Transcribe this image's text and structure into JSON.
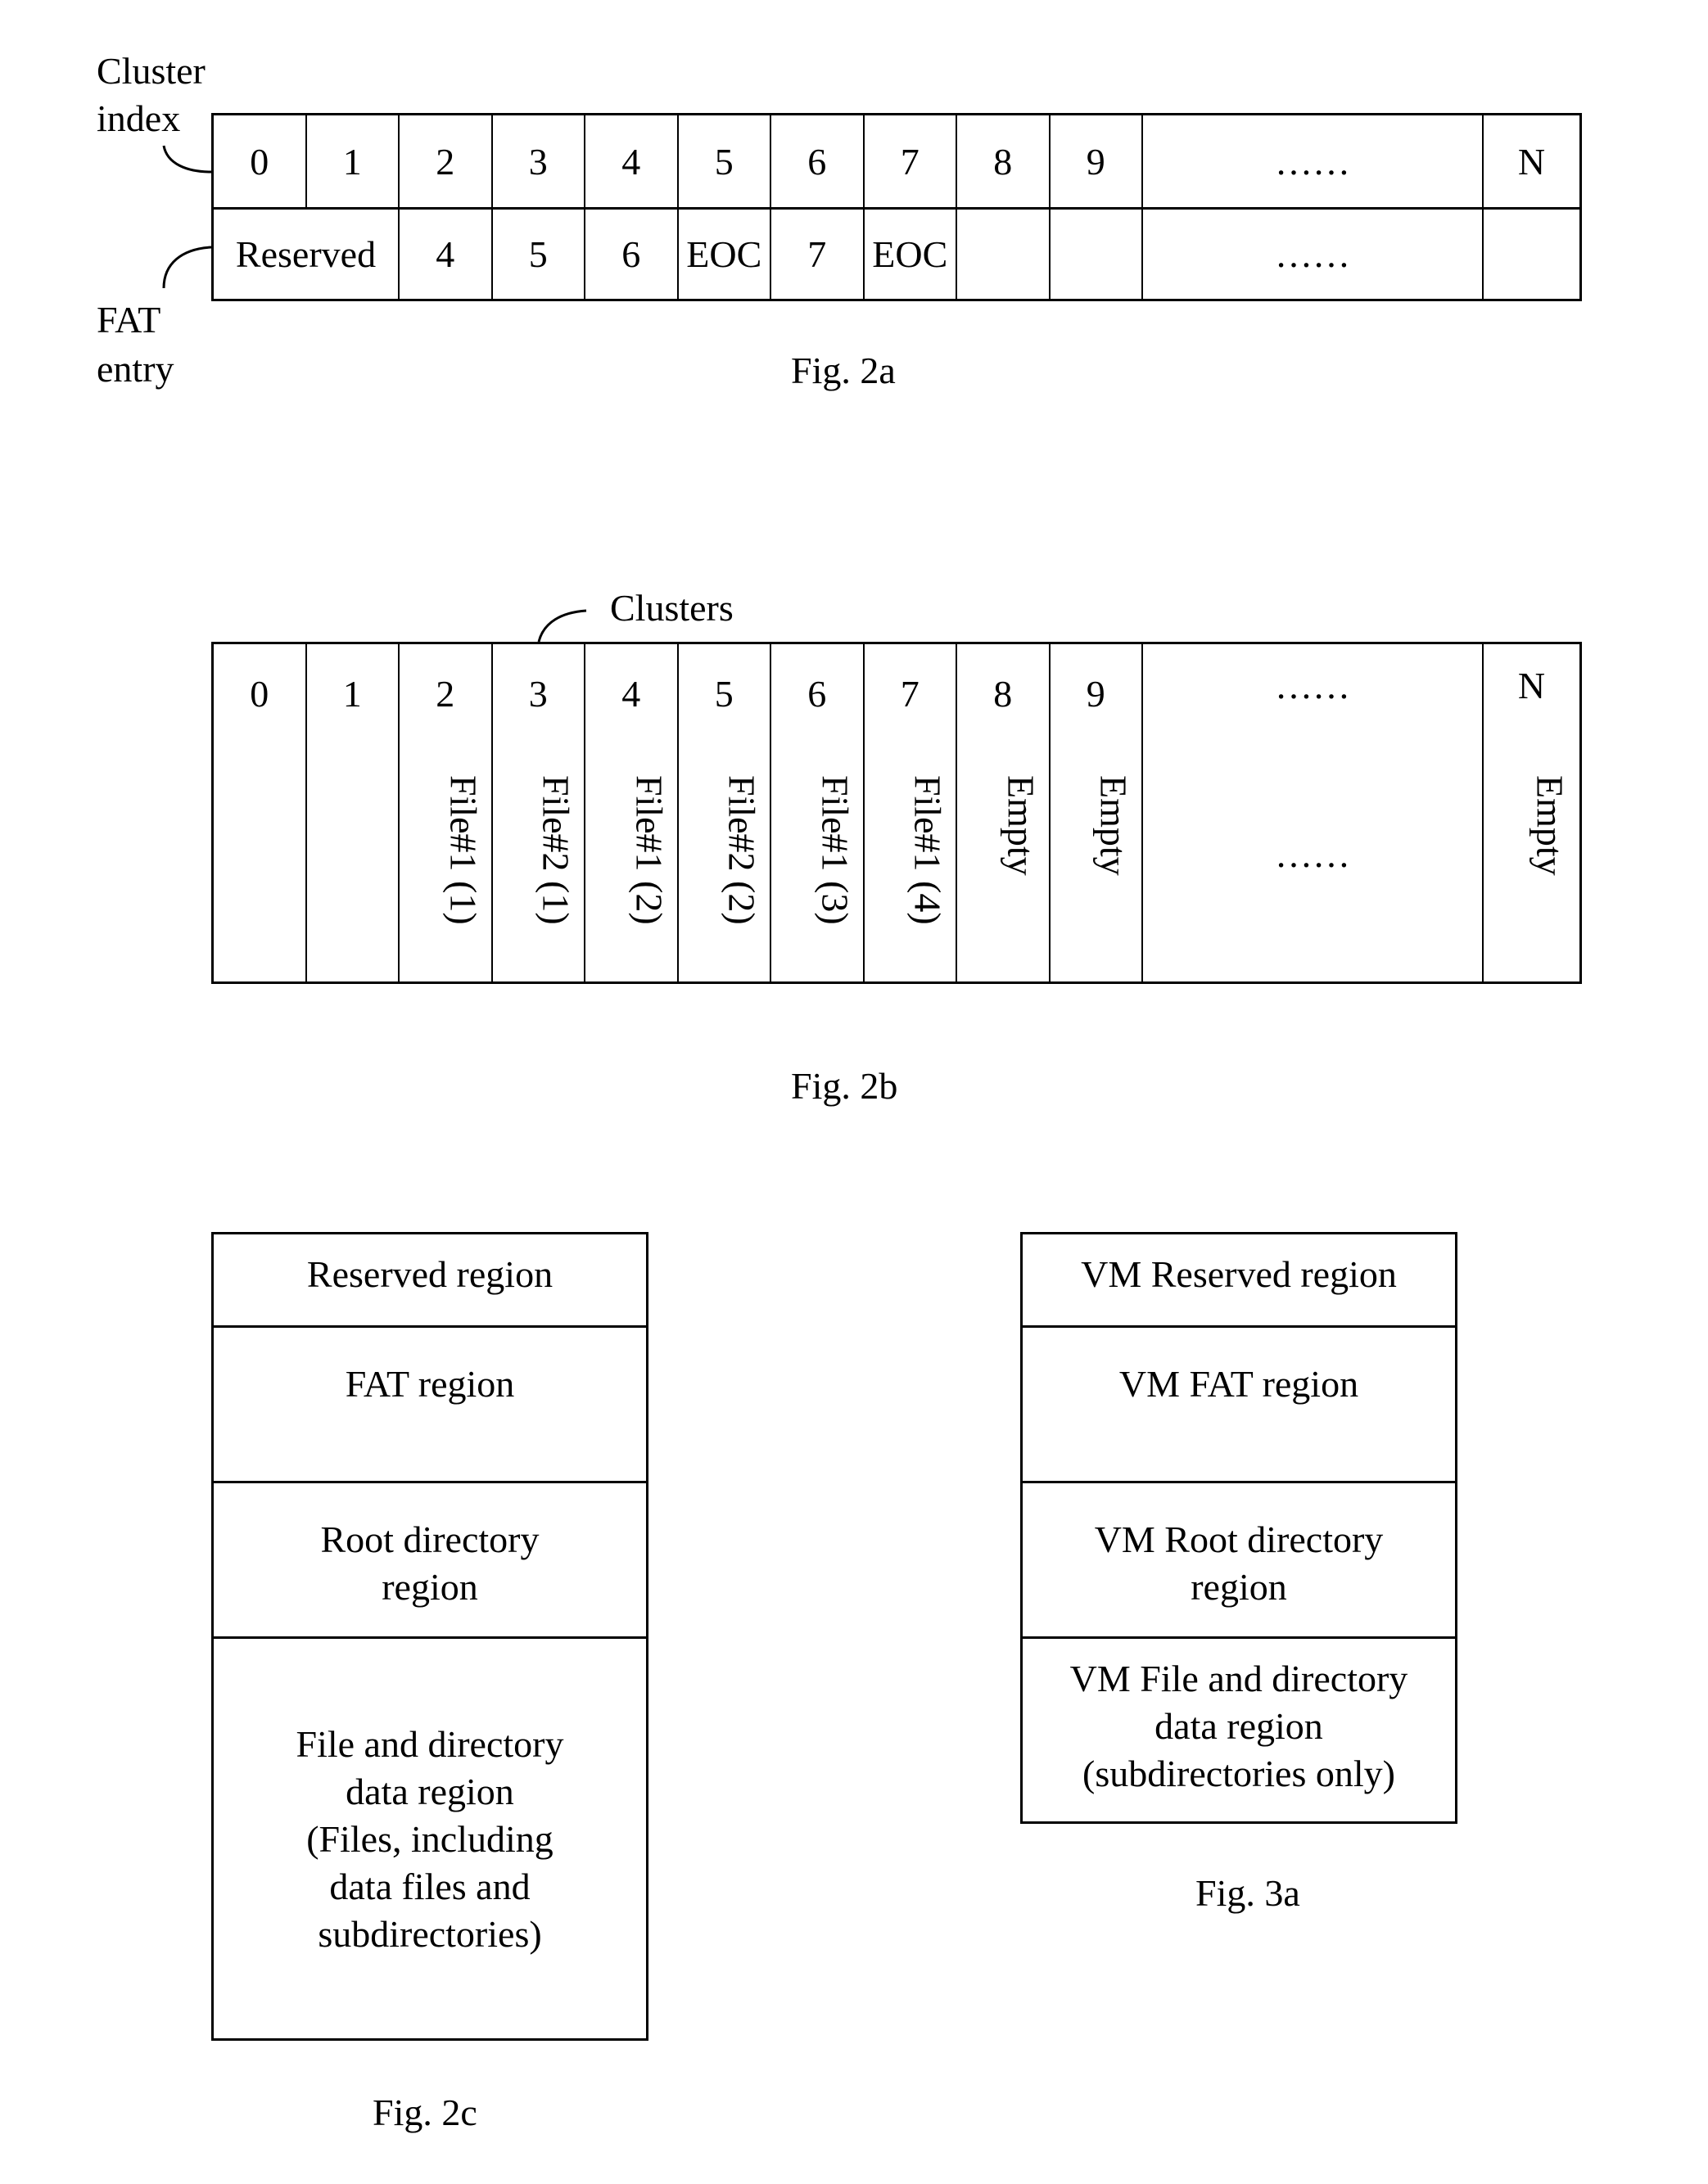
{
  "fig2a": {
    "caption": "Fig. 2a",
    "label_top": [
      "Cluster",
      "index"
    ],
    "label_bottom": [
      "FAT",
      "entry"
    ],
    "index_row": [
      "0",
      "1",
      "2",
      "3",
      "4",
      "5",
      "6",
      "7",
      "8",
      "9",
      "……",
      "N"
    ],
    "entry_row": [
      "Reserved",
      "4",
      "5",
      "6",
      "EOC",
      "7",
      "EOC",
      "",
      "",
      "……",
      ""
    ]
  },
  "fig2b": {
    "caption": "Fig. 2b",
    "label": "Clusters",
    "columns": [
      {
        "index": "0",
        "content": ""
      },
      {
        "index": "1",
        "content": ""
      },
      {
        "index": "2",
        "content": "File#1 (1)"
      },
      {
        "index": "3",
        "content": "File#2 (1)"
      },
      {
        "index": "4",
        "content": "File#1 (2)"
      },
      {
        "index": "5",
        "content": "File#2 (2)"
      },
      {
        "index": "6",
        "content": "File#1 (3)"
      },
      {
        "index": "7",
        "content": "File#1 (4)"
      },
      {
        "index": "8",
        "content": "Empty"
      },
      {
        "index": "9",
        "content": "Empty"
      },
      {
        "index": "……",
        "content": "……"
      },
      {
        "index": "N",
        "content": "Empty"
      }
    ]
  },
  "fig2c": {
    "caption": "Fig. 2c",
    "regions": [
      [
        "Reserved region"
      ],
      [
        "FAT region"
      ],
      [
        "Root directory",
        "region"
      ],
      [
        "File and directory",
        "data region",
        "(Files, including",
        "data files and",
        "subdirectories)"
      ]
    ]
  },
  "fig3a": {
    "caption": "Fig. 3a",
    "regions": [
      [
        "VM Reserved region"
      ],
      [
        "VM FAT region"
      ],
      [
        "VM Root directory",
        "region"
      ],
      [
        "VM File and directory",
        "data region",
        "(subdirectories only)"
      ]
    ]
  }
}
